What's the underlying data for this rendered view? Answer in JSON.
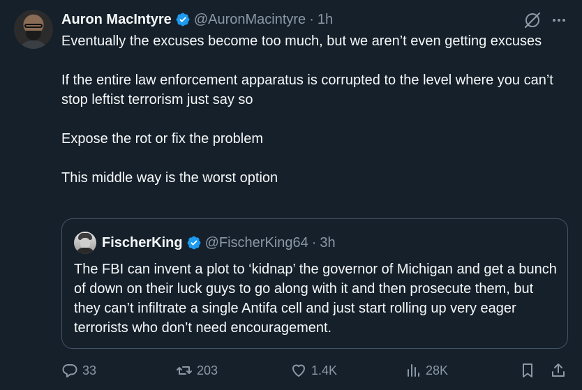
{
  "author": {
    "name": "Auron MacIntyre",
    "handle": "@AuronMacintyre",
    "time": "1h",
    "verified": true
  },
  "separator": "·",
  "body": [
    "Eventually the excuses become too much, but we aren’t even getting excuses",
    "If the entire law enforcement apparatus is corrupted to the level where you can’t stop leftist terrorism just say so",
    "Expose the rot or fix the problem",
    "This middle way is the worst option"
  ],
  "quote": {
    "name": "FischerKing",
    "handle": "@FischerKing64",
    "time": "3h",
    "verified": true,
    "text": "The FBI can invent a plot to ‘kidnap’ the governor of Michigan and get a bunch of down on their luck guys to go along with it and then prosecute them, but they can’t infiltrate a single Antifa cell and just start rolling up very eager terrorists who don’t need encouragement."
  },
  "actions": {
    "replies": "33",
    "reposts": "203",
    "likes": "1.4K",
    "views": "28K"
  },
  "colors": {
    "background": "#15202b",
    "text": "#f7f9f9",
    "muted": "#8b98a5",
    "verified_blue": "#1d9bf0",
    "border": "#425364"
  },
  "icons": [
    "grok-icon",
    "more-icon",
    "verified-badge-icon",
    "reply-icon",
    "retweet-icon",
    "heart-icon",
    "views-icon",
    "bookmark-icon",
    "share-icon"
  ]
}
